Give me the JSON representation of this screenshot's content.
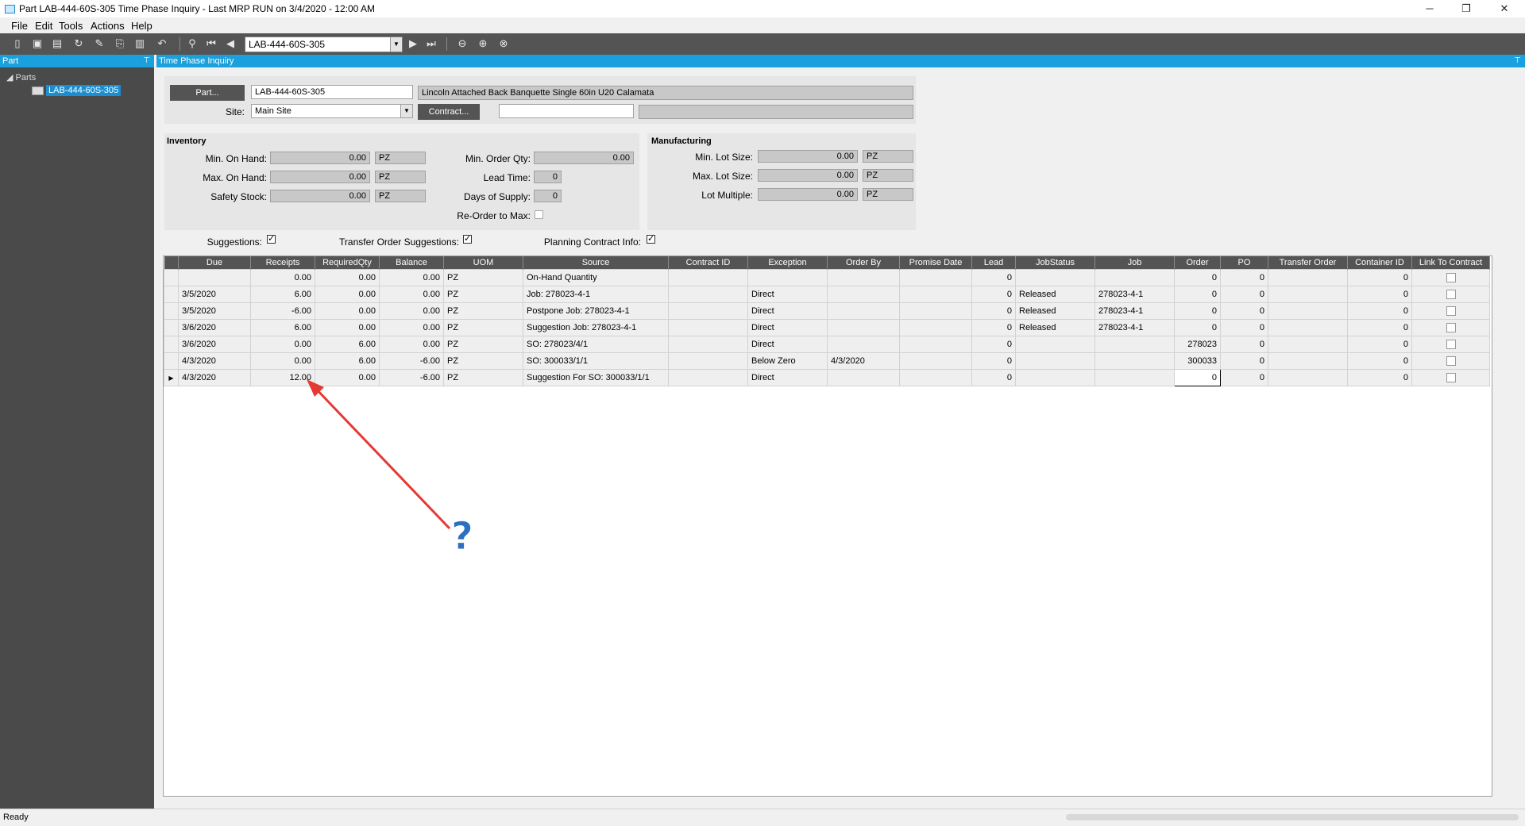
{
  "window": {
    "title": "Part LAB-444-60S-305 Time Phase Inquiry  - Last MRP RUN on 3/4/2020 - 12:00 AM",
    "minimize": "─",
    "restore": "❐",
    "close": "✕"
  },
  "menu": [
    "File",
    "Edit",
    "Tools",
    "Actions",
    "Help"
  ],
  "toolbar": {
    "nav_value": "LAB-444-60S-305"
  },
  "left_panel": {
    "title": "Part",
    "tree_root": "Parts",
    "tree_node": "LAB-444-60S-305"
  },
  "main_panel": {
    "title": "Time Phase Inquiry"
  },
  "header": {
    "part_button": "Part...",
    "part_value": "LAB-444-60S-305",
    "part_description": "Lincoln Attached Back Banquette Single 60in  U20 Calamata",
    "site_label": "Site:",
    "site_value": "Main Site",
    "contract_button": "Contract...",
    "contract_value": "",
    "contract_description": ""
  },
  "inventory": {
    "title": "Inventory",
    "min_on_hand_label": "Min. On Hand:",
    "min_on_hand": "0.00",
    "min_on_hand_uom": "PZ",
    "max_on_hand_label": "Max. On Hand:",
    "max_on_hand": "0.00",
    "max_on_hand_uom": "PZ",
    "safety_stock_label": "Safety Stock:",
    "safety_stock": "0.00",
    "safety_stock_uom": "PZ",
    "min_order_qty_label": "Min. Order Qty:",
    "min_order_qty": "0.00",
    "lead_time_label": "Lead Time:",
    "lead_time": "0",
    "days_of_supply_label": "Days of Supply:",
    "days_of_supply": "0",
    "reorder_to_max_label": "Re-Order to Max:"
  },
  "manufacturing": {
    "title": "Manufacturing",
    "min_lot_size_label": "Min. Lot Size:",
    "min_lot_size": "0.00",
    "min_lot_size_uom": "PZ",
    "max_lot_size_label": "Max. Lot Size:",
    "max_lot_size": "0.00",
    "max_lot_size_uom": "PZ",
    "lot_multiple_label": "Lot Multiple:",
    "lot_multiple": "0.00",
    "lot_multiple_uom": "PZ"
  },
  "options": {
    "suggestions_label": "Suggestions:",
    "suggestions_checked": true,
    "transfer_order_label": "Transfer Order Suggestions:",
    "transfer_order_checked": true,
    "planning_contract_label": "Planning Contract Info:",
    "planning_contract_checked": true
  },
  "grid": {
    "columns": [
      "Due",
      "Receipts",
      "RequiredQty",
      "Balance",
      "UOM",
      "Source",
      "Contract ID",
      "Exception",
      "Order By",
      "Promise Date",
      "Lead",
      "JobStatus",
      "Job",
      "Order",
      "PO",
      "Transfer Order",
      "Container ID",
      "Link To Contract"
    ],
    "rows": [
      {
        "due": "",
        "receipts": "0.00",
        "required": "0.00",
        "balance": "0.00",
        "uom": "PZ",
        "source": "On-Hand Quantity",
        "contract": "",
        "exception": "",
        "order_by": "",
        "promise": "",
        "lead": "0",
        "job_status": "",
        "job": "",
        "order": "0",
        "po": "0",
        "transfer": "",
        "container": "0"
      },
      {
        "due": "3/5/2020",
        "receipts": "6.00",
        "required": "0.00",
        "balance": "0.00",
        "uom": "PZ",
        "source": "Job: 278023-4-1",
        "contract": "",
        "exception": "Direct",
        "order_by": "",
        "promise": "",
        "lead": "0",
        "job_status": "Released",
        "job": "278023-4-1",
        "order": "0",
        "po": "0",
        "transfer": "",
        "container": "0"
      },
      {
        "due": "3/5/2020",
        "receipts": "-6.00",
        "required": "0.00",
        "balance": "0.00",
        "uom": "PZ",
        "source": "Postpone Job: 278023-4-1",
        "contract": "",
        "exception": "Direct",
        "order_by": "",
        "promise": "",
        "lead": "0",
        "job_status": "Released",
        "job": "278023-4-1",
        "order": "0",
        "po": "0",
        "transfer": "",
        "container": "0"
      },
      {
        "due": "3/6/2020",
        "receipts": "6.00",
        "required": "0.00",
        "balance": "0.00",
        "uom": "PZ",
        "source": "Suggestion Job: 278023-4-1",
        "contract": "",
        "exception": "Direct",
        "order_by": "",
        "promise": "",
        "lead": "0",
        "job_status": "Released",
        "job": "278023-4-1",
        "order": "0",
        "po": "0",
        "transfer": "",
        "container": "0"
      },
      {
        "due": "3/6/2020",
        "receipts": "0.00",
        "required": "6.00",
        "balance": "0.00",
        "uom": "PZ",
        "source": "SO: 278023/4/1",
        "contract": "",
        "exception": "Direct",
        "order_by": "",
        "promise": "",
        "lead": "0",
        "job_status": "",
        "job": "",
        "order": "278023",
        "po": "0",
        "transfer": "",
        "container": "0"
      },
      {
        "due": "4/3/2020",
        "receipts": "0.00",
        "required": "6.00",
        "balance": "-6.00",
        "uom": "PZ",
        "source": "SO: 300033/1/1",
        "contract": "",
        "exception": "Below Zero",
        "order_by": "4/3/2020",
        "promise": "",
        "lead": "0",
        "job_status": "",
        "job": "",
        "order": "300033",
        "po": "0",
        "transfer": "",
        "container": "0"
      },
      {
        "due": "4/3/2020",
        "receipts": "12.00",
        "required": "0.00",
        "balance": "-6.00",
        "uom": "PZ",
        "source": "Suggestion For SO: 300033/1/1",
        "contract": "",
        "exception": "Direct",
        "order_by": "",
        "promise": "",
        "lead": "0",
        "job_status": "",
        "job": "",
        "order": "0",
        "po": "0",
        "transfer": "",
        "container": "0"
      }
    ]
  },
  "annotation": {
    "symbol": "?",
    "color": "#e53935",
    "mark_color": "#2f6fc0"
  },
  "status": {
    "text": "Ready"
  }
}
